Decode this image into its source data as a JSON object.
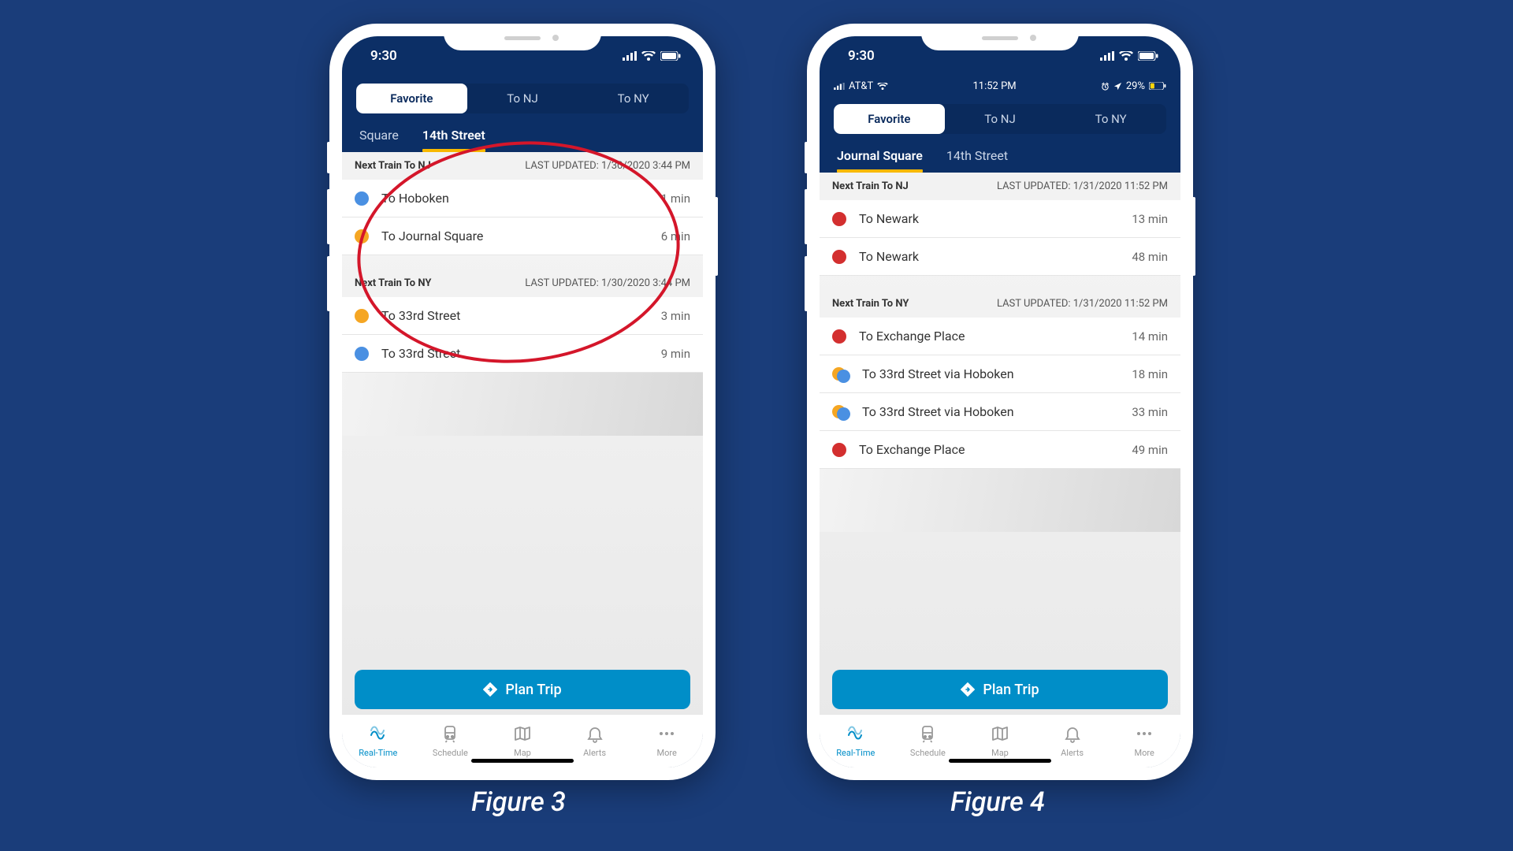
{
  "captions": {
    "fig3": "Figure 3",
    "fig4": "Figure 4"
  },
  "colors": {
    "blue": "#4a90e2",
    "orange": "#f5a623",
    "red": "#d32f2f"
  },
  "phoneA": {
    "status_time": "9:30",
    "segments": {
      "favorite": "Favorite",
      "to_nj": "To NJ",
      "to_ny": "To NY"
    },
    "stations": {
      "left": "Square",
      "right": "14th Street",
      "active": "right"
    },
    "sections": [
      {
        "title": "Next Train To NJ",
        "updated": "LAST UPDATED: 1/30/2020 3:44 PM",
        "rows": [
          {
            "colors": [
              "blue"
            ],
            "dest": "To Hoboken",
            "eta": "1 min"
          },
          {
            "colors": [
              "orange"
            ],
            "dest": "To Journal Square",
            "eta": "6 min"
          }
        ]
      },
      {
        "title": "Next Train To NY",
        "updated": "LAST UPDATED: 1/30/2020 3:44 PM",
        "rows": [
          {
            "colors": [
              "orange"
            ],
            "dest": "To 33rd Street",
            "eta": "3 min"
          },
          {
            "colors": [
              "blue"
            ],
            "dest": "To 33rd Street",
            "eta": "9 min"
          }
        ]
      }
    ],
    "plan_label": "Plan Trip"
  },
  "phoneB": {
    "status_time": "9:30",
    "secondary_status": {
      "carrier": "AT&T",
      "clock": "11:52 PM",
      "battery": "29%"
    },
    "segments": {
      "favorite": "Favorite",
      "to_nj": "To NJ",
      "to_ny": "To NY"
    },
    "stations": {
      "left": "Journal Square",
      "right": "14th Street",
      "active": "left"
    },
    "sections": [
      {
        "title": "Next Train To NJ",
        "updated": "LAST UPDATED: 1/31/2020 11:52 PM",
        "rows": [
          {
            "colors": [
              "red"
            ],
            "dest": "To Newark",
            "eta": "13 min"
          },
          {
            "colors": [
              "red"
            ],
            "dest": "To Newark",
            "eta": "48 min"
          }
        ]
      },
      {
        "title": "Next Train To NY",
        "updated": "LAST UPDATED: 1/31/2020 11:52 PM",
        "rows": [
          {
            "colors": [
              "red"
            ],
            "dest": "To Exchange Place",
            "eta": "14 min"
          },
          {
            "colors": [
              "orange",
              "blue"
            ],
            "dest": "To 33rd Street via Hoboken",
            "eta": "18 min"
          },
          {
            "colors": [
              "orange",
              "blue"
            ],
            "dest": "To 33rd Street via Hoboken",
            "eta": "33 min"
          },
          {
            "colors": [
              "red"
            ],
            "dest": "To Exchange Place",
            "eta": "49 min"
          }
        ]
      }
    ],
    "plan_label": "Plan Trip"
  },
  "tabbar": {
    "items": [
      {
        "id": "realtime",
        "label": "Real-Time"
      },
      {
        "id": "schedule",
        "label": "Schedule"
      },
      {
        "id": "map",
        "label": "Map"
      },
      {
        "id": "alerts",
        "label": "Alerts"
      },
      {
        "id": "more",
        "label": "More"
      }
    ],
    "active": "realtime"
  }
}
